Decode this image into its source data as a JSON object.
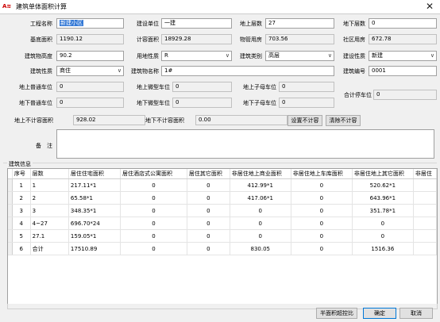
{
  "window": {
    "title": "建筑单体面积计算",
    "app_badge": "A≋",
    "close": "✕"
  },
  "form": {
    "project_name_label": "工程名称",
    "project_name_value": "新建小区",
    "builder_label": "建设单位",
    "builder_value": "一建",
    "above_floors_label": "地上层数",
    "above_floors_value": "27",
    "below_floors_label": "地下层数",
    "below_floors_value": "0",
    "base_area_label": "基底面积",
    "base_area_value": "1190.12",
    "plot_area_label": "计容面积",
    "plot_area_value": "18929.28",
    "property_label": "物管用房",
    "property_value": "703.56",
    "community_label": "社区用房",
    "community_value": "672.78",
    "height_label": "建筑物高度",
    "height_value": "90.2",
    "land_use_label": "用地性质",
    "land_use_value": "R",
    "building_type_label": "建筑类别",
    "building_type_value": "高层",
    "construction_label": "建设性质",
    "construction_value": "新建",
    "building_nature_label": "建筑性质",
    "building_nature_value": "商住",
    "building_name_label": "建筑物名称",
    "building_name_value": "1#",
    "building_no_label": "建筑编号",
    "building_no_value": "0001",
    "above_normal_park_label": "地上普通车位",
    "above_normal_park_value": "0",
    "above_mini_park_label": "地上微型车位",
    "above_mini_park_value": "0",
    "above_mother_park_label": "地上子母车位",
    "above_mother_park_value": "0",
    "below_normal_park_label": "地下普通车位",
    "below_normal_park_value": "0",
    "below_mini_park_label": "地下微型车位",
    "below_mini_park_value": "0",
    "below_mother_park_label": "地下子母车位",
    "below_mother_park_value": "0",
    "total_park_label": "合计停车位",
    "total_park_value": "0",
    "above_noncount_label": "地上不计容面积",
    "above_noncount_value": "928.02",
    "below_noncount_label": "地下不计容面积",
    "below_noncount_value": "0.00",
    "set_noncount_btn": "设置不计容",
    "clear_noncount_btn": "清除不计容",
    "remark_label": "备　注",
    "remark_value": ""
  },
  "table": {
    "section_label": "建筑信息",
    "columns": [
      "序号",
      "层数",
      "居住住宅面积",
      "居住酒店式公寓面积",
      "居住其它面积",
      "非居住地上商业面积",
      "非居住地上车库面积",
      "非居住地上其它面积",
      "非居住"
    ],
    "rows": [
      [
        "1",
        "1",
        "217.11*1",
        "0",
        "0",
        "412.99*1",
        "0",
        "520.62*1",
        ""
      ],
      [
        "2",
        "2",
        "65.58*1",
        "0",
        "0",
        "417.06*1",
        "0",
        "643.96*1",
        ""
      ],
      [
        "3",
        "3",
        "348.35*1",
        "0",
        "0",
        "0",
        "0",
        "351.78*1",
        ""
      ],
      [
        "4",
        "4~27",
        "696.70*24",
        "0",
        "0",
        "0",
        "0",
        "0",
        ""
      ],
      [
        "5",
        "27.1",
        "159.05*1",
        "0",
        "0",
        "0",
        "0",
        "0",
        ""
      ],
      [
        "6",
        "合计",
        "17510.89",
        "0",
        "0",
        "830.05",
        "0",
        "1516.36",
        ""
      ]
    ]
  },
  "footer": {
    "ratio_btn": "半面积超控比",
    "ok_btn": "确定",
    "cancel_btn": "取消"
  }
}
